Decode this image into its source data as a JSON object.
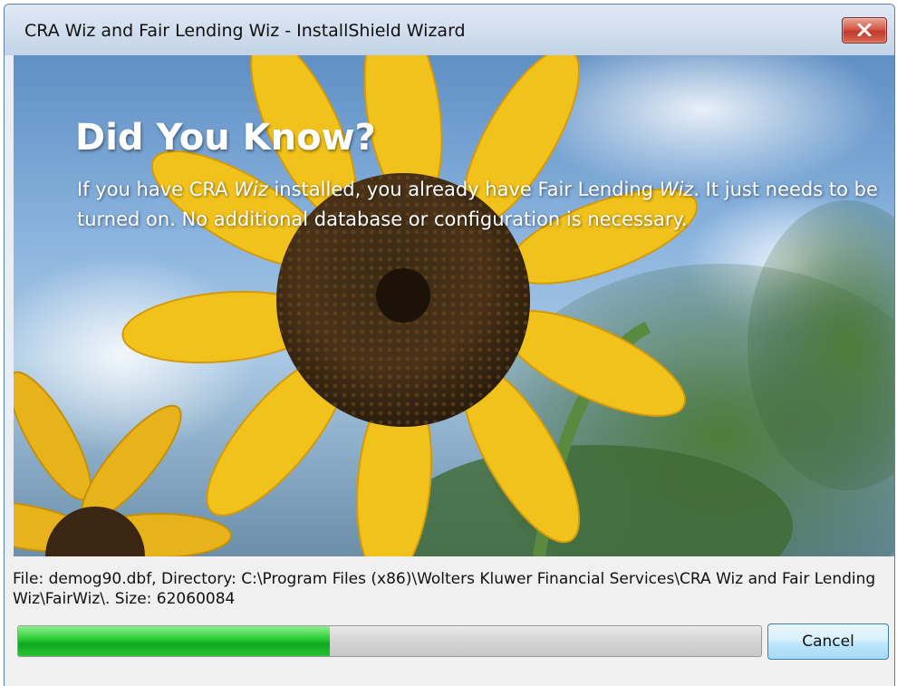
{
  "window": {
    "title": "CRA Wiz and Fair Lending Wiz - InstallShield Wizard",
    "close_icon": "close-x-icon"
  },
  "banner": {
    "heading": "Did You Know?",
    "body_part1": "If you have CRA ",
    "body_em1": "Wiz",
    "body_part2": " installed, you already have Fair Lending ",
    "body_em2": "Wiz",
    "body_part3": ". It just needs to be turned on. No additional database or configuration is necessary."
  },
  "status": {
    "text": "File: demog90.dbf, Directory: C:\\Program Files (x86)\\Wolters Kluwer Financial Services\\CRA Wiz and Fair Lending Wiz\\FairWiz\\. Size: 62060084",
    "progress": 0.42,
    "progress_color": "#1fc02c"
  },
  "buttons": {
    "cancel_label": "Cancel"
  }
}
